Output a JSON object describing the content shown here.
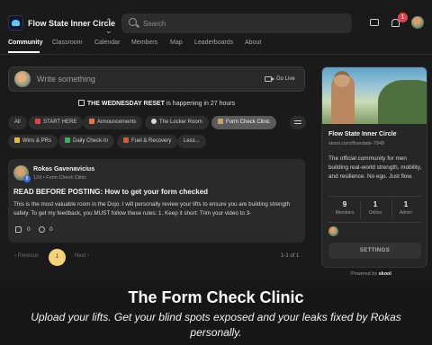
{
  "header": {
    "community_name": "Flow State Inner Circle",
    "search_placeholder": "Search",
    "notification_count": "1"
  },
  "nav_tabs": [
    {
      "label": "Community",
      "active": true
    },
    {
      "label": "Classroom"
    },
    {
      "label": "Calendar"
    },
    {
      "label": "Members"
    },
    {
      "label": "Map"
    },
    {
      "label": "Leaderboards"
    },
    {
      "label": "About"
    }
  ],
  "composer": {
    "placeholder": "Write something",
    "go_live_label": "Go Live"
  },
  "event_banner": {
    "name": "THE WEDNESDAY RESET",
    "suffix": " is happening in 27 hours"
  },
  "categories": [
    {
      "label": "All"
    },
    {
      "label": "START HERE",
      "icon": "pin-icon",
      "color": "#e0424b"
    },
    {
      "label": "Announcements",
      "icon": "megaphone-icon",
      "color": "#e07a3b"
    },
    {
      "label": "The Locker Room",
      "icon": "speech-bubble-icon",
      "color": "#d8d8d8"
    },
    {
      "label": "Form Check Clinic",
      "icon": "clipboard-icon",
      "color": "#c8a36a",
      "active": true
    },
    {
      "label": "Wins & PRs",
      "icon": "trophy-icon",
      "color": "#e6b93c"
    },
    {
      "label": "Daily Check-In",
      "icon": "checkbox-icon",
      "color": "#3fae5a"
    },
    {
      "label": "Fuel & Recovery",
      "icon": "meat-icon",
      "color": "#d0603c"
    },
    {
      "label": "Less..."
    }
  ],
  "post": {
    "author": "Rokas Gavenavicius",
    "level": "8",
    "meta": "12d  •  Form Check Clinic",
    "title": "READ BEFORE POSTING: How to get your form checked",
    "body": "This is the most valuable room in the Dojo. I will personally review your lifts to ensure you are building strength safely. To get my feedback, you MUST follow these rules: 1. Keep it short: Trim your video to 3-",
    "likes": "0",
    "comments": "0"
  },
  "pagination": {
    "prev_label": "Previous",
    "current_page": "1",
    "next_label": "Next",
    "count_label": "1-1 of 1"
  },
  "sidebar_card": {
    "title": "Flow State Inner Circle",
    "url": "skool.com/flowstate-7949",
    "description": "The official community for men building real-world strength, mobility, and resilience. No ego. Just flow.",
    "stats": [
      {
        "value": "9",
        "label": "Members"
      },
      {
        "value": "1",
        "label": "Online"
      },
      {
        "value": "1",
        "label": "Admin"
      }
    ],
    "settings_label": "SETTINGS"
  },
  "powered_by": {
    "prefix": "Powered by",
    "brand": "skool"
  },
  "caption": {
    "title": "The Form Check Clinic",
    "subtitle": "Upload your lifts. Get your blind spots exposed and your leaks fixed by Rokas personally."
  },
  "colors": {
    "background": "#1a1a1a",
    "card": "#2a2a2a",
    "active_page": "#f5d27c",
    "notification": "#e0424b"
  }
}
